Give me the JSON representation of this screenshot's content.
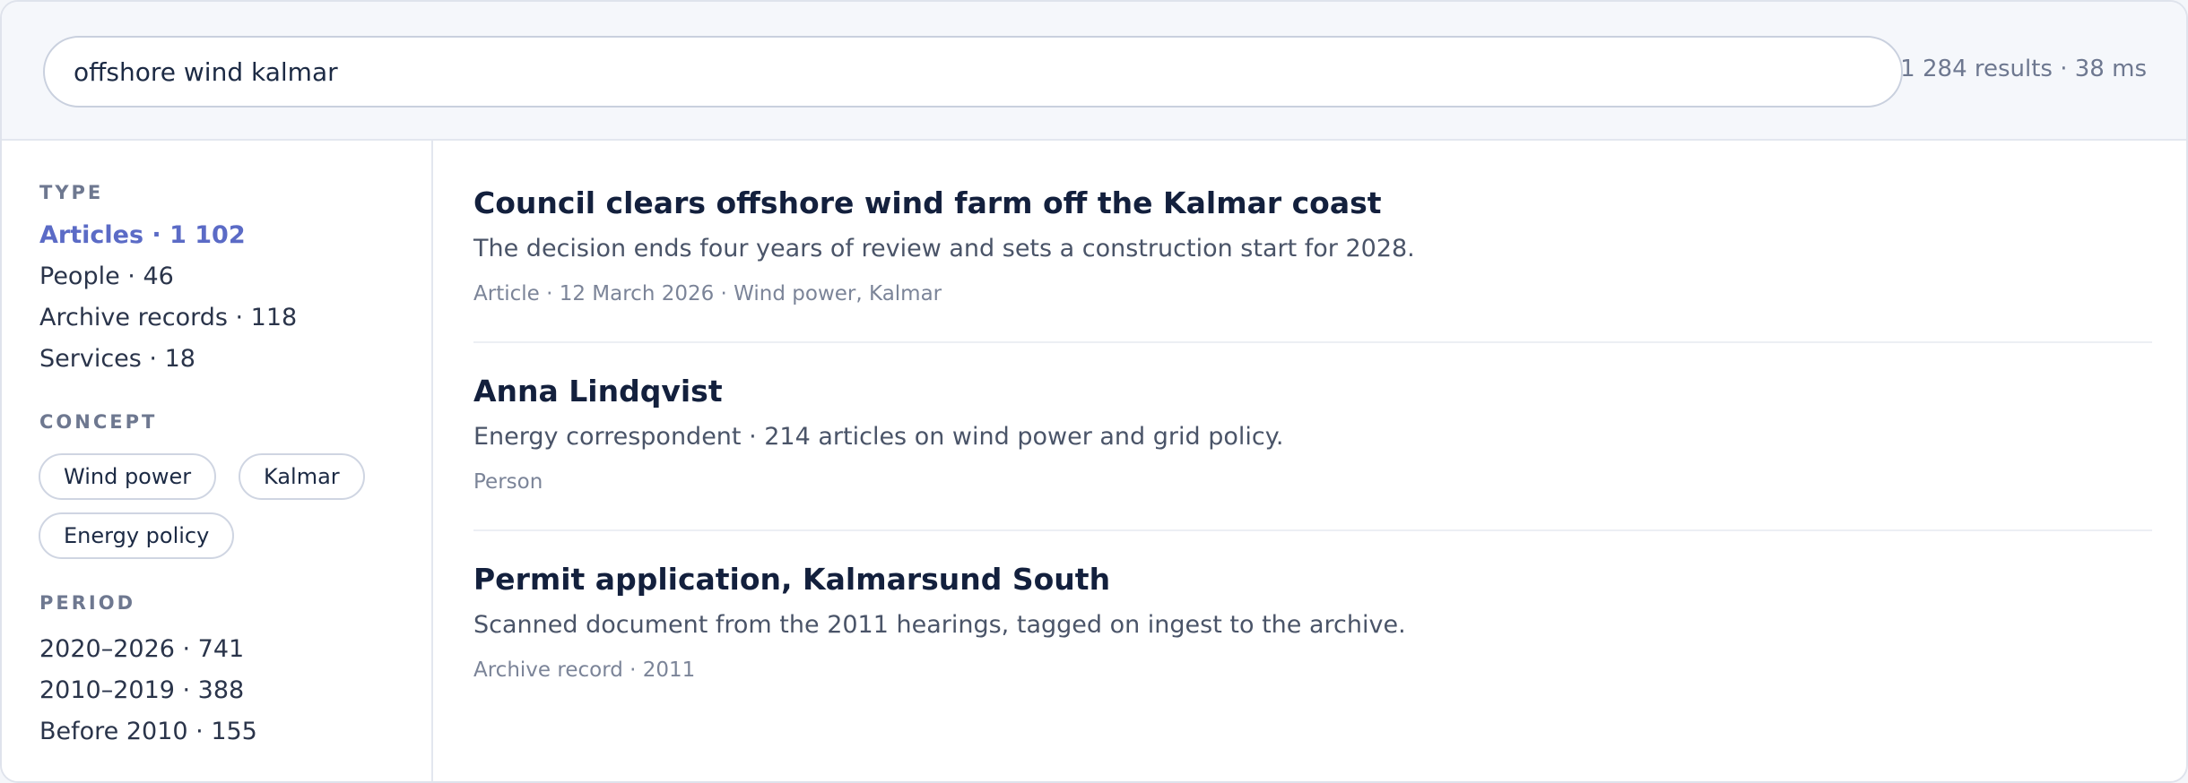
{
  "search": {
    "query": "offshore wind kalmar",
    "result_summary": "1 284 results · 38 ms"
  },
  "sidebar": {
    "type": {
      "heading": "TYPE",
      "items": [
        {
          "label": "Articles · 1 102",
          "active": true
        },
        {
          "label": "People · 46",
          "active": false
        },
        {
          "label": "Archive records · 118",
          "active": false
        },
        {
          "label": "Services · 18",
          "active": false
        }
      ]
    },
    "concept": {
      "heading": "CONCEPT",
      "chips": [
        "Wind power",
        "Kalmar",
        "Energy policy"
      ]
    },
    "period": {
      "heading": "PERIOD",
      "items": [
        {
          "label": "2020–2026 · 741"
        },
        {
          "label": "2010–2019 · 388"
        },
        {
          "label": "Before 2010 · 155"
        }
      ]
    }
  },
  "results": [
    {
      "title": "Council clears offshore wind farm off the Kalmar coast",
      "snippet": "The decision ends four years of review and sets a construction start for 2028.",
      "meta": "Article · 12 March 2026 · Wind power, Kalmar"
    },
    {
      "title": "Anna Lindqvist",
      "snippet": "Energy correspondent · 214 articles on wind power and grid policy.",
      "meta": "Person"
    },
    {
      "title": "Permit application, Kalmarsund South",
      "snippet": "Scanned document from the 2011 hearings, tagged on ingest to the archive.",
      "meta": "Archive record · 2011"
    }
  ],
  "colors": {
    "accent": "#5b6bc6",
    "title": "#13203d",
    "muted": "#6e7890",
    "border": "#dfe3ec",
    "header_bg": "#f5f7fb"
  }
}
